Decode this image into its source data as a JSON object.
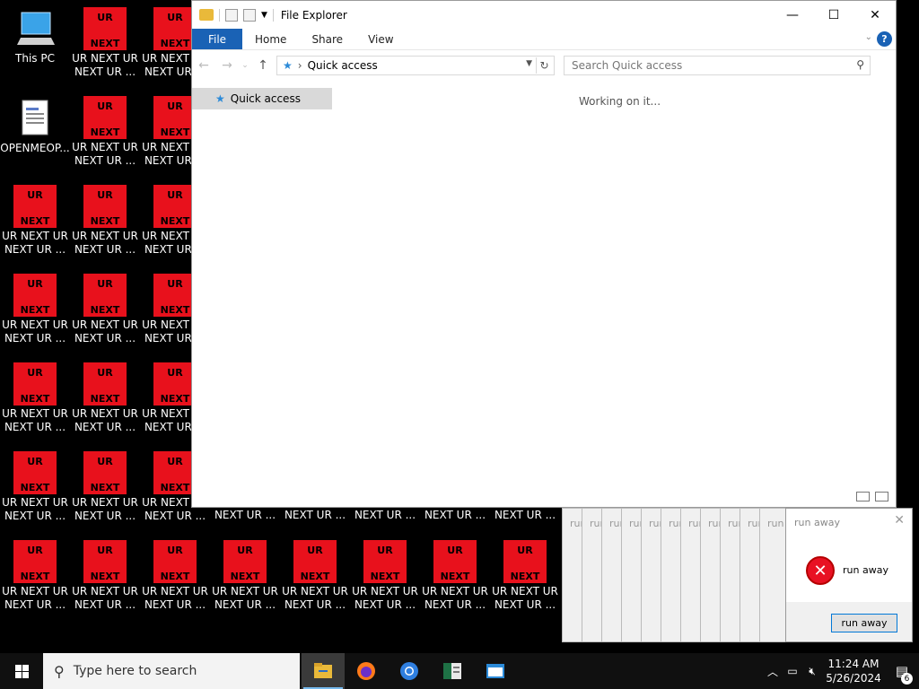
{
  "desktop": {
    "this_pc": "This PC",
    "doc": "OPENMEOP...",
    "ur_top": "UR",
    "ur_bottom": "NEXT",
    "ur_label": "UR NEXT UR\nNEXT UR ...",
    "ur_label_short": "NEXT UR ..."
  },
  "explorer": {
    "title": "File Explorer",
    "tabs": [
      "File",
      "Home",
      "Share",
      "View"
    ],
    "help": "?",
    "address": "Quick access",
    "search_placeholder": "Search Quick access",
    "nav_item": "Quick access",
    "status": "Working on it..."
  },
  "dialog": {
    "title": "run away",
    "message": "run away",
    "button": "run away",
    "ghost_title": "run"
  },
  "taskbar": {
    "search_placeholder": "Type here to search",
    "time": "11:24 AM",
    "date": "5/26/2024",
    "notification_count": "6"
  },
  "colors": {
    "ur_red": "#e8111c",
    "accent": "#1a62b5"
  }
}
